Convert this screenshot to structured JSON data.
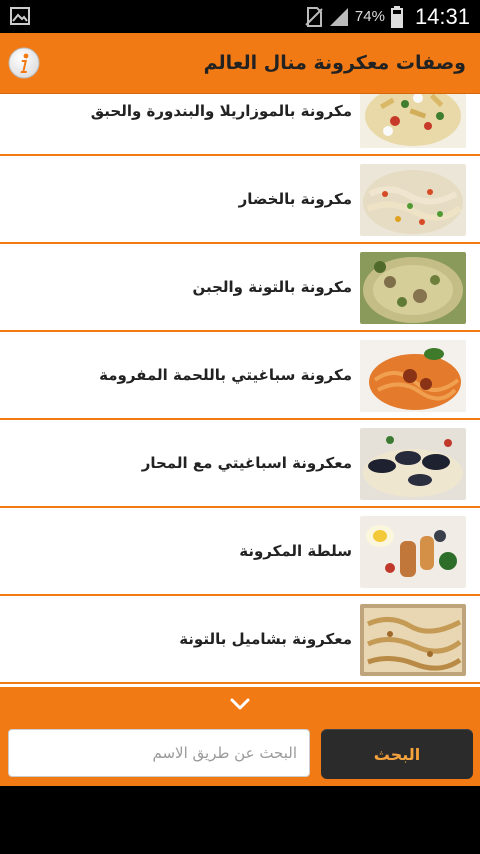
{
  "status_bar": {
    "battery_percent": "74%",
    "time": "14:31",
    "icons": [
      "gallery-icon",
      "no-sim-icon",
      "signal-icon",
      "battery-icon"
    ]
  },
  "app_bar": {
    "title": "وصفات معكرونة منال العالم",
    "info_icon": "info-icon",
    "accent_color": "#f27a15"
  },
  "recipes": [
    {
      "name": "مكرونة بالموزاريلا والبندورة والحبق",
      "image": "pasta-mozzarella-photo"
    },
    {
      "name": "مكرونة بالخضار",
      "image": "pasta-vegetables-photo"
    },
    {
      "name": "مكرونة بالتونة والجبن",
      "image": "pasta-tuna-cheese-photo"
    },
    {
      "name": "مكرونة سباغيتي باللحمة المفرومة",
      "image": "spaghetti-meat-photo"
    },
    {
      "name": "معكرونة اسباغيتي مع المحار",
      "image": "spaghetti-shellfish-photo"
    },
    {
      "name": "سلطة المكرونة",
      "image": "pasta-salad-photo"
    },
    {
      "name": "معكرونة بشاميل بالتونة",
      "image": "pasta-bechamel-photo"
    }
  ],
  "more_icon": "chevron-down-icon",
  "search": {
    "placeholder": "البحث عن طريق الاسم",
    "button_label": "البحث"
  }
}
